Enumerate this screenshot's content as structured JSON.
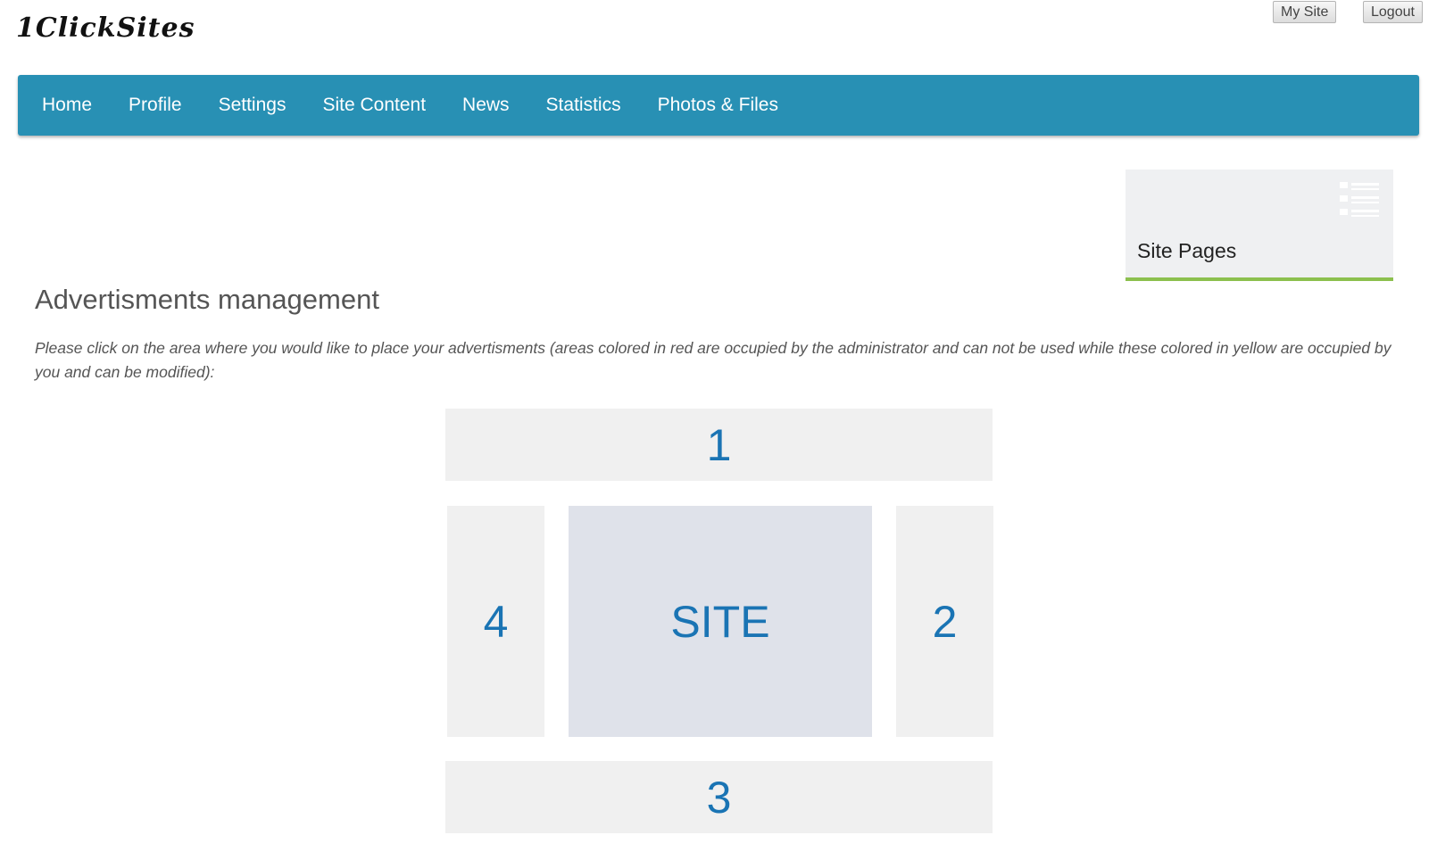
{
  "header": {
    "logo_text": "1ClickSites",
    "my_site_label": "My Site",
    "logout_label": "Logout"
  },
  "nav": {
    "items": [
      {
        "label": "Home"
      },
      {
        "label": "Profile"
      },
      {
        "label": "Settings"
      },
      {
        "label": "Site Content"
      },
      {
        "label": "News"
      },
      {
        "label": "Statistics"
      },
      {
        "label": "Photos & Files"
      }
    ],
    "background_color": "#2890b4"
  },
  "tile": {
    "label": "Site Pages",
    "icon": "list-icon",
    "accent_color": "#8cc04e"
  },
  "main": {
    "title": "Advertisments management",
    "description": "Please click on the area where you would like to place your advertisments (areas colored in red are occupied by the administrator and can not be used while these colored in yellow are occupied by you and can be modified):"
  },
  "ad_layout": {
    "area_1": "1",
    "area_2": "2",
    "area_3": "3",
    "area_4": "4",
    "site_label": "SITE",
    "label_color": "#1a74b4",
    "area_color": "#f0f0f0",
    "site_color": "#dfe2ea"
  }
}
